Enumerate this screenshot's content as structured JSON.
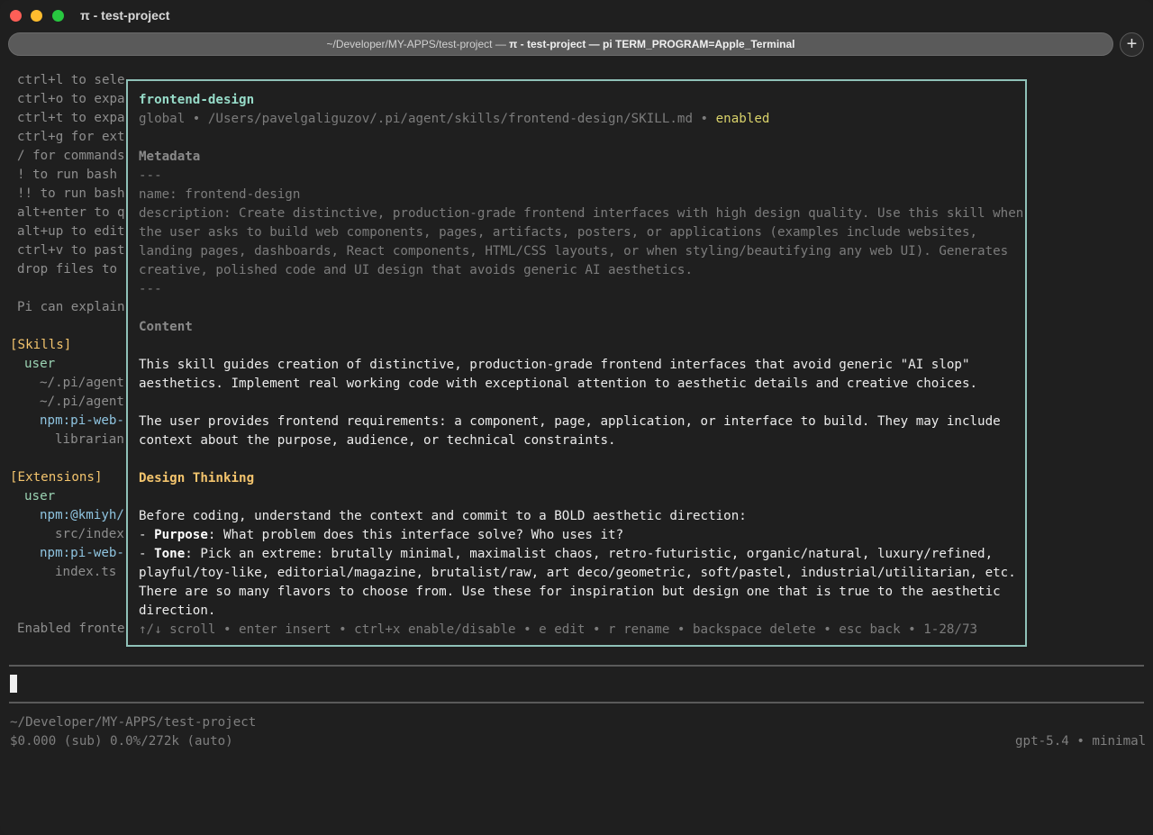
{
  "window": {
    "title": "π - test-project",
    "tab_path": "~/Developer/MY-APPS/test-project",
    "tab_sep": " — ",
    "tab_bold": "π - test-project — pi TERM_PROGRAM=Apple_Terminal",
    "new_tab_label": "+"
  },
  "background": {
    "hint_lines": [
      "ctrl+l to sele",
      "ctrl+o to expa",
      "ctrl+t to expa",
      "ctrl+g for ext",
      "/ for commands",
      "! to run bash",
      "!! to run bash",
      "alt+enter to q",
      "alt+up to edit",
      "ctrl+v to past",
      "drop files to"
    ],
    "explain_line": "Pi can explain",
    "skills_header": "[Skills]",
    "skills_user": "user",
    "skills_items": [
      "~/.pi/agent",
      "~/.pi/agent",
      "npm:pi-web-",
      "librarian"
    ],
    "ext_header": "[Extensions]",
    "ext_user": "user",
    "ext_items": [
      "npm:@kmiyh/",
      "src/index",
      "npm:pi-web-",
      "index.ts"
    ],
    "enabled_line": "Enabled fronte"
  },
  "overlay": {
    "name": "frontend-design",
    "location_prefix": "global • /Users/pavelgaliguzov/.pi/agent/skills/frontend-design/SKILL.md • ",
    "status": "enabled",
    "metadata_heading": "Metadata",
    "meta_lines": [
      "---",
      "name: frontend-design",
      "description: Create distinctive, production-grade frontend interfaces with high design quality. Use this skill when",
      "the user asks to build web components, pages, artifacts, posters, or applications (examples include websites,",
      "landing pages, dashboards, React components, HTML/CSS layouts, or when styling/beautifying any web UI). Generates",
      "creative, polished code and UI design that avoids generic AI aesthetics.",
      "---"
    ],
    "content_heading": "Content",
    "content_p1": [
      "This skill guides creation of distinctive, production-grade frontend interfaces that avoid generic \"AI slop\"",
      "aesthetics. Implement real working code with exceptional attention to aesthetic details and creative choices."
    ],
    "content_p2": [
      "The user provides frontend requirements: a component, page, application, or interface to build. They may include",
      "context about the purpose, audience, or technical constraints."
    ],
    "design_heading": "Design Thinking",
    "design_intro": "Before coding, understand the context and commit to a BOLD aesthetic direction:",
    "purpose_label": "Purpose",
    "purpose_text": ": What problem does this interface solve? Who uses it?",
    "tone_label": "Tone",
    "tone_text": ": Pick an extreme: brutally minimal, maximalist chaos, retro-futuristic, organic/natural, luxury/refined,",
    "tone_cont": [
      "playful/toy-like, editorial/magazine, brutalist/raw, art deco/geometric, soft/pastel, industrial/utilitarian, etc.",
      "There are so many flavors to choose from. Use these for inspiration but design one that is true to the aesthetic",
      "direction."
    ],
    "footer": "↑/↓ scroll • enter insert • ctrl+x enable/disable • e edit • r rename • backspace delete • esc back • 1-28/73"
  },
  "status_bar": {
    "cwd": "~/Developer/MY-APPS/test-project",
    "usage": "$0.000 (sub) 0.0%/272k (auto)",
    "model": "gpt-5.4 • minimal"
  }
}
